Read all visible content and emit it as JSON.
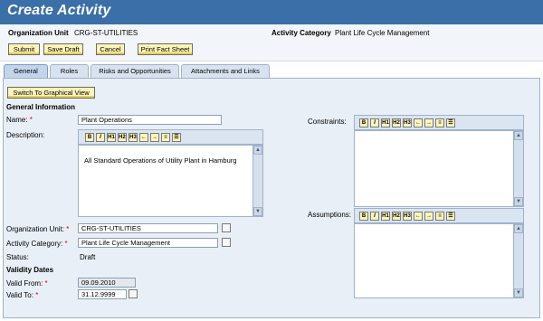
{
  "header": {
    "title": "Create Activity"
  },
  "subheader": {
    "org_unit_label": "Organization Unit",
    "org_unit_value": "CRG-ST-UTILITIES",
    "category_label": "Activity Category",
    "category_value": "Plant Life Cycle Management"
  },
  "toolbar": {
    "submit": "Submit",
    "save_draft": "Save Draft",
    "cancel": "Cancel",
    "print_fact_sheet": "Print Fact Sheet"
  },
  "tabs": [
    {
      "label": "General",
      "active": true
    },
    {
      "label": "Roles"
    },
    {
      "label": "Risks and Opportunities"
    },
    {
      "label": "Attachments and Links"
    }
  ],
  "form": {
    "graphical_view_button": "Switch To Graphical View",
    "section_general": "General Information",
    "name_label": "Name:",
    "name_value": "Plant Operations",
    "description_label": "Description:",
    "description_text": "All Standard Operations of Utility Plant in Hamburg",
    "org_unit_label": "Organization Unit:",
    "org_unit_value": "CRG-ST-UTILITIES",
    "category_label": "Activity Category:",
    "category_value": "Plant Life Cycle Management",
    "status_label": "Status:",
    "status_value": "Draft",
    "section_validity": "Validity Dates",
    "valid_from_label": "Valid From:",
    "valid_from_value": "09.09.2010",
    "valid_to_label": "Valid To:",
    "valid_to_value": "31.12.9999",
    "constraints_label": "Constraints:",
    "assumptions_label": "Assumptions:",
    "required_marker": "*"
  },
  "rte_buttons": [
    "B",
    "I",
    "H1",
    "H2",
    "H3",
    "←",
    "→",
    "≡",
    "☰"
  ],
  "colors": {
    "header_bg": "#3a6fa8",
    "panel_bg": "#e9eff6",
    "button_bg": "#fdf4b8",
    "required": "#dd0000"
  }
}
